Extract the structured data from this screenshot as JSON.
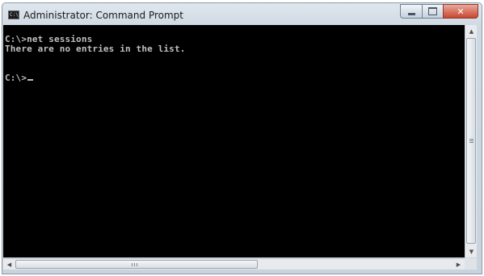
{
  "window": {
    "title": "Administrator: Command Prompt",
    "icon": "cmd-icon",
    "icon_text": "C:\\",
    "buttons": [
      "minimize-icon",
      "maximize-icon",
      "close-icon"
    ],
    "close_label": "✕"
  },
  "console": {
    "lines": [
      "C:\\>net sessions",
      "There are no entries in the list.",
      "",
      "C:\\>"
    ],
    "text_color": "#c0c0c0",
    "background": "#000000"
  },
  "colors": {
    "close_button": "#c8462f",
    "titlebar": "#cfd9e3"
  }
}
